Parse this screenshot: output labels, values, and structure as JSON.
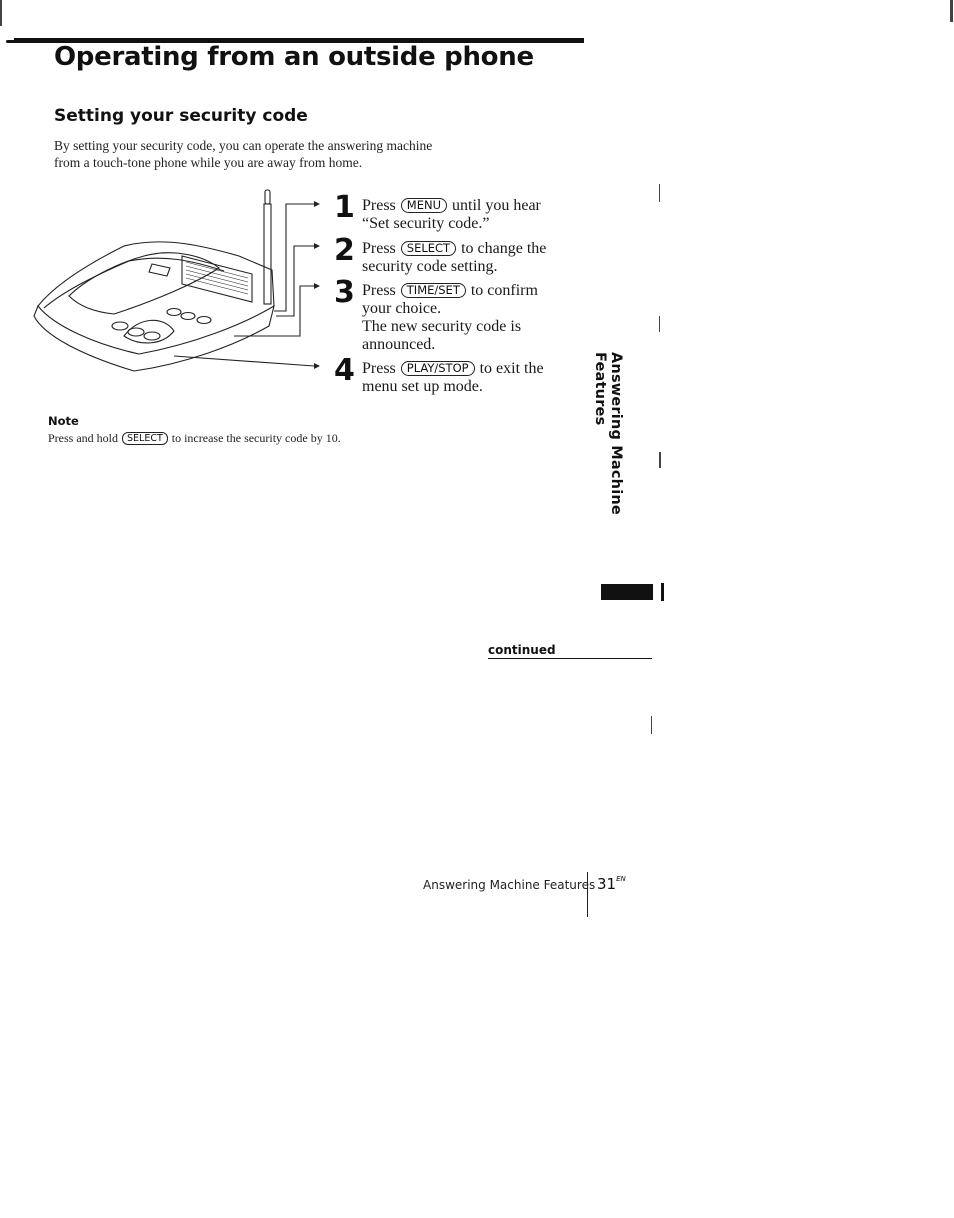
{
  "page": {
    "title": "Operating from an outside phone",
    "section_title": "Setting your security code",
    "intro_lines": [
      "By setting your security code, you can operate the answering machine",
      "from a touch-tone phone while you are away from home."
    ]
  },
  "steps": [
    {
      "number": "1",
      "before": "Press",
      "key": "MENU",
      "after": "until you hear",
      "lines": [
        "“Set security code.”"
      ]
    },
    {
      "number": "2",
      "before": "Press",
      "key": "SELECT",
      "after": "to change the",
      "lines": [
        "security code setting."
      ]
    },
    {
      "number": "3",
      "before": "Press",
      "key": "TIME/SET",
      "after": "to confirm",
      "lines": [
        "your choice.",
        "The new security code is",
        "announced."
      ]
    },
    {
      "number": "4",
      "before": "Press",
      "key": "PLAY/STOP",
      "after": "to exit the",
      "lines": [
        "menu set up mode."
      ]
    }
  ],
  "note": {
    "heading": "Note",
    "before": "Press and hold",
    "key": "SELECT",
    "after": "to increase the security code by 10."
  },
  "side_tab": {
    "label": "Answering Machine Features"
  },
  "continued_label": "continued",
  "footer": {
    "section_label": "Answering Machine Features",
    "page_number": "31",
    "page_suffix": "EN"
  },
  "illustration": {
    "icon": "answering-machine-illustration"
  }
}
